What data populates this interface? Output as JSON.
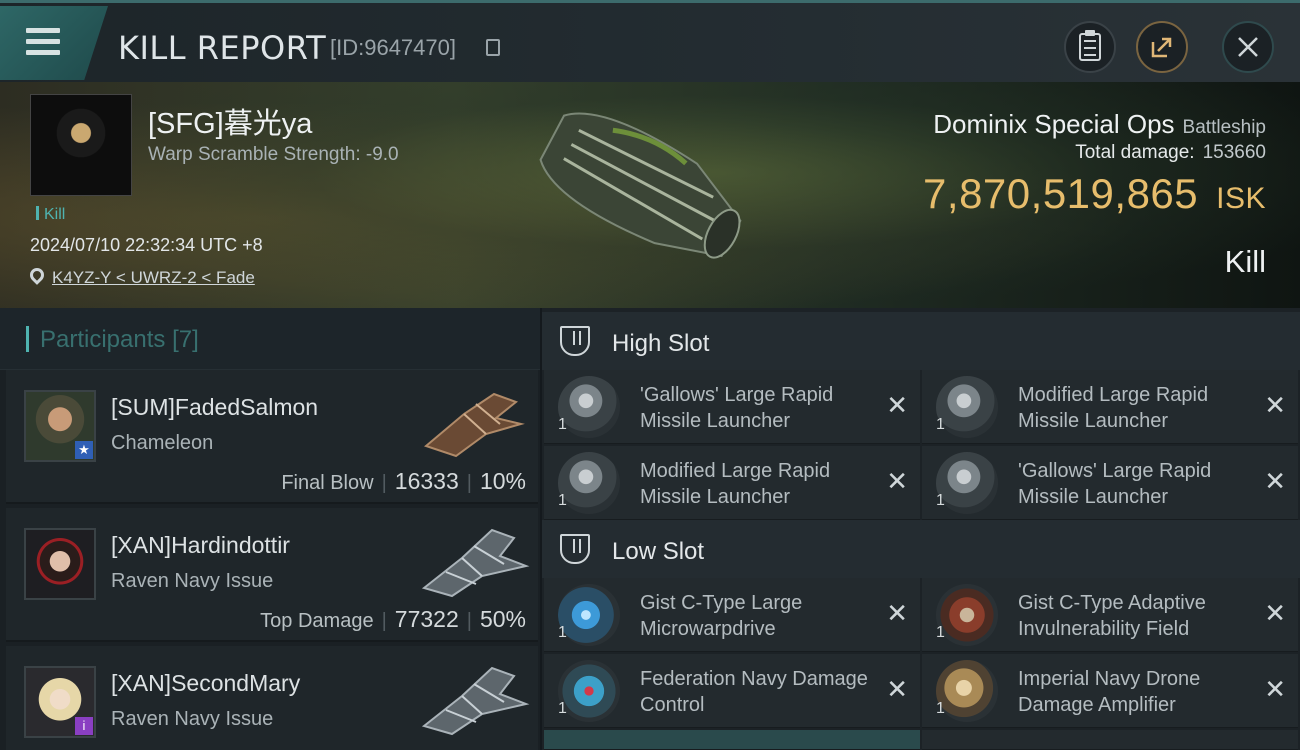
{
  "header": {
    "title": "KILL REPORT",
    "report_id": "[ID:9647470]"
  },
  "victim": {
    "name": "[SFG]暮光ya",
    "warp_scramble": "Warp Scramble Strength: -9.0",
    "kill_tag": "Kill",
    "timestamp": "2024/07/10 22:32:34 UTC +8",
    "location": "K4YZ-Y < UWRZ-2 < Fade",
    "ship_name": "Dominix Special Ops",
    "ship_class": "Battleship",
    "total_damage_label": "Total damage:",
    "total_damage_value": "153660",
    "isk_value": "7,870,519,865",
    "isk_unit": "ISK",
    "result": "Kill"
  },
  "participants": {
    "label": "Participants",
    "count": "[7]",
    "rows": [
      {
        "name": "[SUM]FadedSalmon",
        "ship": "Chameleon",
        "tag": "Final Blow",
        "damage": "16333",
        "percent": "10%",
        "badge_icon": "star-icon",
        "badge_color": "#2f5fb5"
      },
      {
        "name": "[XAN]Hardindottir",
        "ship": "Raven Navy Issue",
        "tag": "Top Damage",
        "damage": "77322",
        "percent": "50%"
      },
      {
        "name": "[XAN]SecondMary",
        "ship": "Raven Navy Issue",
        "badge_icon": "info-icon",
        "badge_color": "#8a3fc2"
      }
    ]
  },
  "fittings": {
    "high_slot": {
      "title": "High Slot",
      "modules": [
        {
          "qty": "1",
          "name": "'Gallows' Large Rapid Missile Launcher"
        },
        {
          "qty": "1",
          "name": "Modified Large Rapid Missile Launcher"
        },
        {
          "qty": "1",
          "name": "Modified Large Rapid Missile Launcher"
        },
        {
          "qty": "1",
          "name": "'Gallows' Large Rapid Missile Launcher"
        }
      ]
    },
    "low_slot": {
      "title": "Low Slot",
      "modules": [
        {
          "qty": "1",
          "name": "Gist C-Type Large Microwarpdrive"
        },
        {
          "qty": "1",
          "name": "Gist C-Type Adaptive Invulnerability Field"
        },
        {
          "qty": "1",
          "name": "Federation Navy Damage Control"
        },
        {
          "qty": "1",
          "name": "Imperial Navy Drone Damage Amplifier"
        }
      ]
    },
    "remove_glyph": "✕"
  },
  "colors": {
    "accent_teal": "#4fb3b0",
    "isk_gold": "#e7bd6c"
  }
}
